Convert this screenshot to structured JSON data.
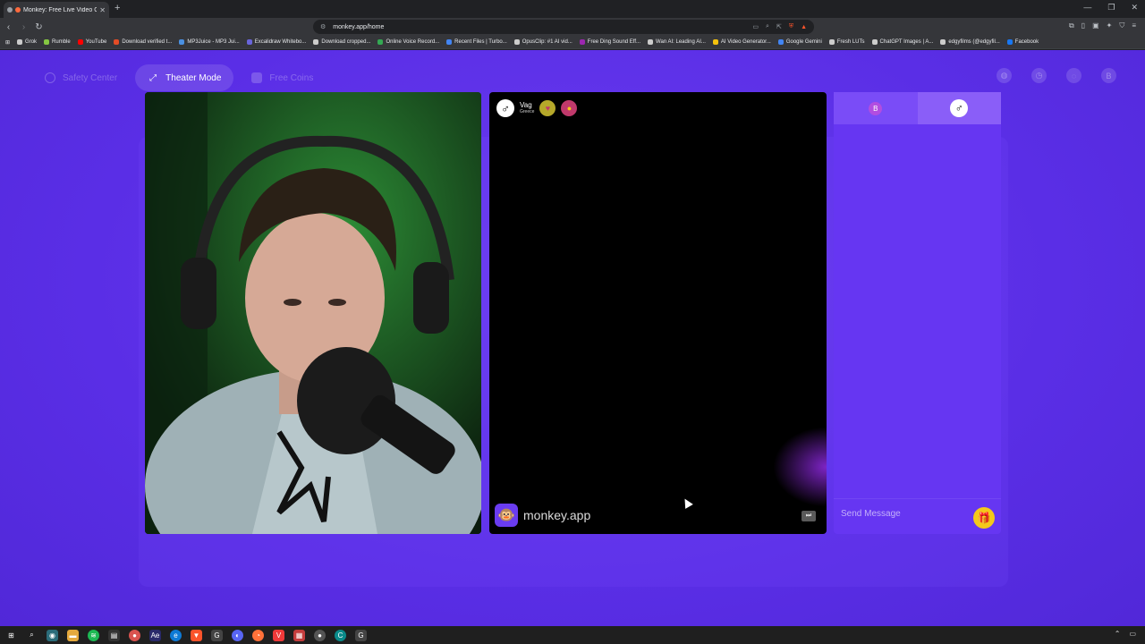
{
  "browser": {
    "tab_title": "Monkey: Free Live Video Chat",
    "new_tab": "+",
    "window_controls": [
      "—",
      "❐",
      "✕"
    ],
    "url": "monkey.app/home",
    "bookmarks": [
      {
        "label": "Grok",
        "color": "#cccccc"
      },
      {
        "label": "Rumble",
        "color": "#85c742"
      },
      {
        "label": "YouTube",
        "color": "#ff0000"
      },
      {
        "label": "Download verified t...",
        "color": "#e34c26"
      },
      {
        "label": "MP3Juice - MP3 Jui...",
        "color": "#4a90e2"
      },
      {
        "label": "Excalidraw Whitebo...",
        "color": "#6965db"
      },
      {
        "label": "Download cropped...",
        "color": "#cccccc"
      },
      {
        "label": "Online Voice Record...",
        "color": "#34a853"
      },
      {
        "label": "Recent Files | Turbo...",
        "color": "#4285f4"
      },
      {
        "label": "OpusClip: #1 AI vid...",
        "color": "#cccccc"
      },
      {
        "label": "Free Ding Sound Eff...",
        "color": "#9c27b0"
      },
      {
        "label": "Wan AI: Leading AI...",
        "color": "#cccccc"
      },
      {
        "label": "AI Video Generator...",
        "color": "#f4c20d"
      },
      {
        "label": "Google Gemini",
        "color": "#4285f4"
      },
      {
        "label": "Fresh LUTs",
        "color": "#cccccc"
      },
      {
        "label": "ChatGPT Images | A...",
        "color": "#cccccc"
      },
      {
        "label": "edgyfilms (@edgyfil...",
        "color": "#cccccc"
      },
      {
        "label": "Facebook",
        "color": "#1877f2"
      }
    ]
  },
  "nav": {
    "safety_center": "Safety Center",
    "theater_mode": "Theater Mode",
    "free_coins": "Free Coins",
    "profile_initial": "B"
  },
  "remote_user": {
    "name": "Vag",
    "country": "Greece"
  },
  "brand": {
    "name": "monkey.app"
  },
  "chat": {
    "my_initial": "B",
    "placeholder": "Send Message"
  },
  "colors": {
    "page_bg": "#5a2ee6",
    "chat_bg": "#6636f2",
    "gift": "#f4c81b",
    "active_pill_text": "#ffffff"
  }
}
